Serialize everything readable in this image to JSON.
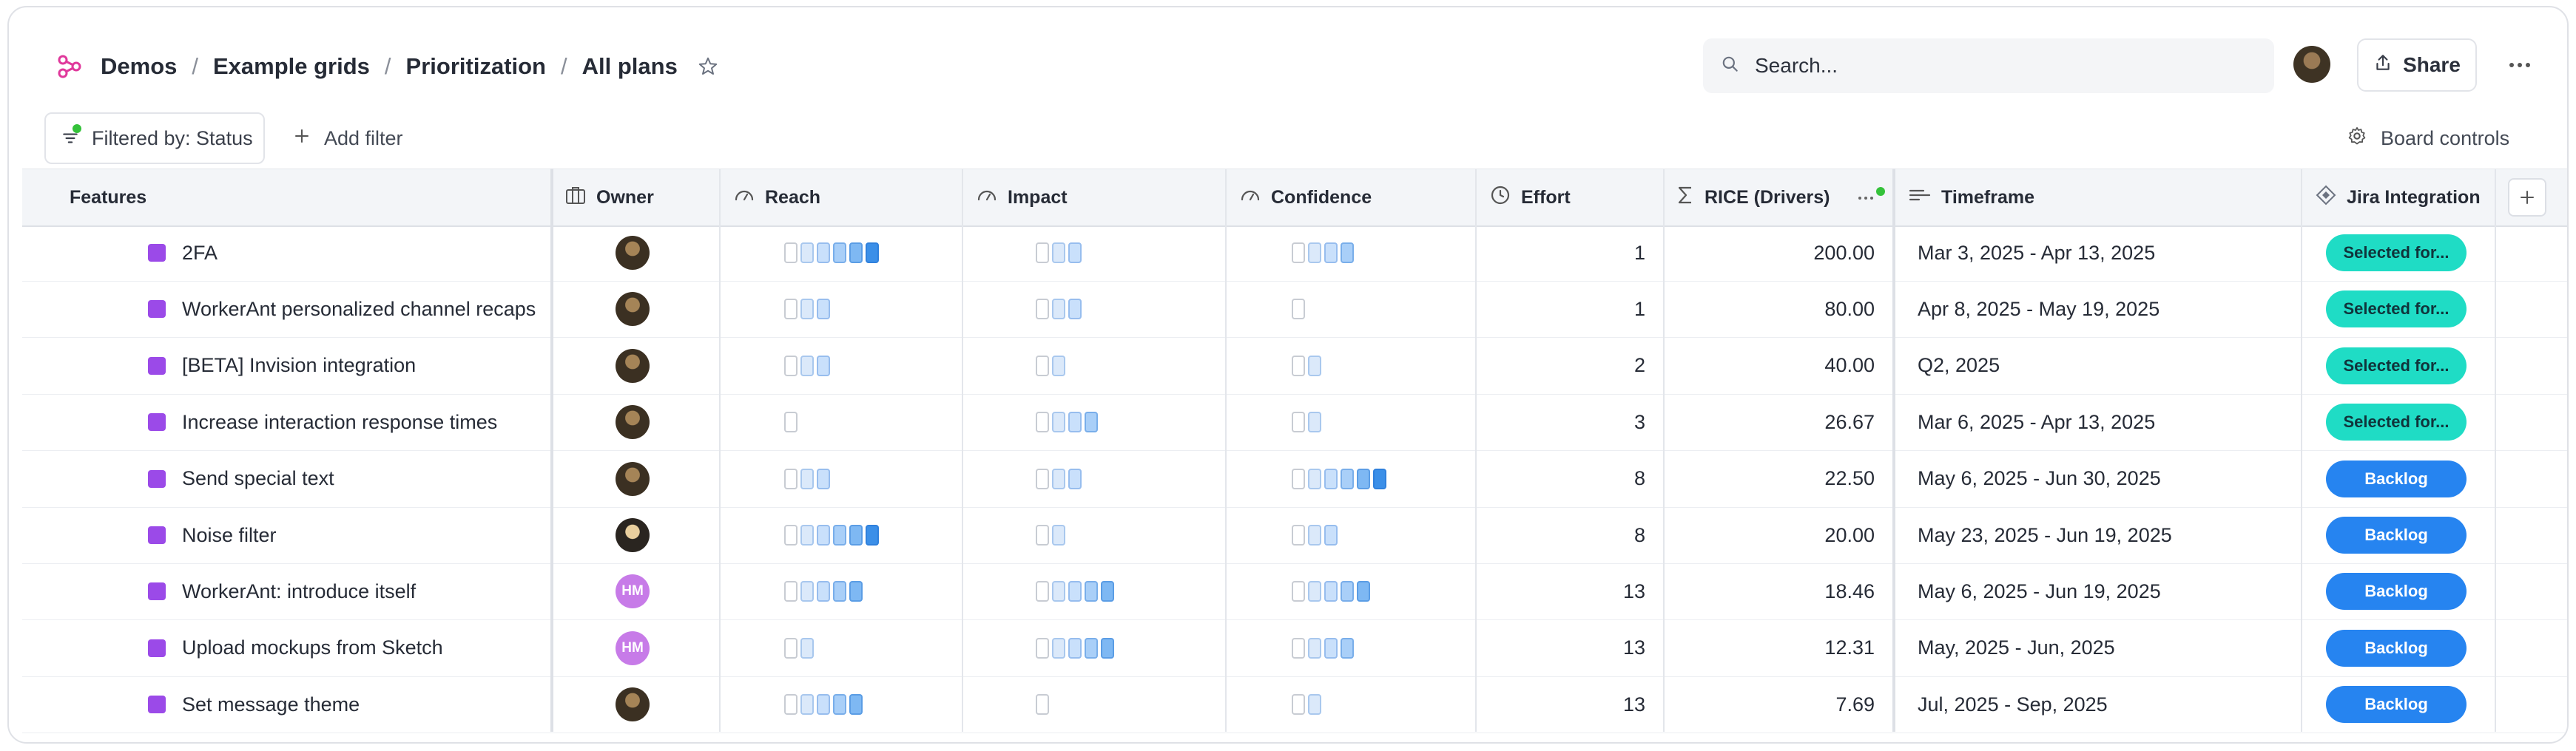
{
  "breadcrumb": [
    "Demos",
    "Example grids",
    "Prioritization",
    "All plans"
  ],
  "search": {
    "placeholder": "Search..."
  },
  "share_label": "Share",
  "filter_label": "Filtered by: Status",
  "add_filter_label": "Add filter",
  "board_controls_label": "Board controls",
  "columns": {
    "features": "Features",
    "owner": "Owner",
    "reach": "Reach",
    "impact": "Impact",
    "confidence": "Confidence",
    "effort": "Effort",
    "rice": "RICE (Drivers)",
    "timeframe": "Timeframe",
    "jira": "Jira Integration"
  },
  "colors": {
    "feature": "#9b4ae8",
    "selected": "#1fdcc5",
    "backlog": "#2684f0",
    "accent": "#e0389b"
  },
  "rows": [
    {
      "name": "2FA",
      "owner": "photo",
      "reach": 6,
      "impact": 3,
      "confidence": 4,
      "effort": "1",
      "rice": "200.00",
      "timeframe": "Mar 3, 2025 - Apr 13, 2025",
      "jira": "Selected for...",
      "jira_status": "selected"
    },
    {
      "name": "WorkerAnt personalized channel recaps",
      "owner": "photo",
      "reach": 3,
      "impact": 3,
      "confidence": 1,
      "effort": "1",
      "rice": "80.00",
      "timeframe": "Apr 8, 2025 - May 19, 2025",
      "jira": "Selected for...",
      "jira_status": "selected"
    },
    {
      "name": "[BETA] Invision integration",
      "owner": "photo",
      "reach": 3,
      "impact": 2,
      "confidence": 2,
      "effort": "2",
      "rice": "40.00",
      "timeframe": "Q2, 2025",
      "jira": "Selected for...",
      "jira_status": "selected"
    },
    {
      "name": "Increase interaction response times",
      "owner": "photo",
      "reach": 1,
      "impact": 4,
      "confidence": 2,
      "effort": "3",
      "rice": "26.67",
      "timeframe": "Mar 6, 2025 - Apr 13, 2025",
      "jira": "Selected for...",
      "jira_status": "selected"
    },
    {
      "name": "Send special text",
      "owner": "photo",
      "reach": 3,
      "impact": 3,
      "confidence": 6,
      "effort": "8",
      "rice": "22.50",
      "timeframe": "May 6, 2025 - Jun 30, 2025",
      "jira": "Backlog",
      "jira_status": "backlog"
    },
    {
      "name": "Noise filter",
      "owner": "photo2",
      "reach": 6,
      "impact": 2,
      "confidence": 3,
      "effort": "8",
      "rice": "20.00",
      "timeframe": "May 23, 2025 - Jun 19, 2025",
      "jira": "Backlog",
      "jira_status": "backlog"
    },
    {
      "name": "WorkerAnt: introduce itself",
      "owner": "HM",
      "reach": 5,
      "impact": 5,
      "confidence": 5,
      "effort": "13",
      "rice": "18.46",
      "timeframe": "May 6, 2025 - Jun 19, 2025",
      "jira": "Backlog",
      "jira_status": "backlog"
    },
    {
      "name": "Upload mockups from Sketch",
      "owner": "HM",
      "reach": 2,
      "impact": 5,
      "confidence": 4,
      "effort": "13",
      "rice": "12.31",
      "timeframe": "May, 2025 - Jun, 2025",
      "jira": "Backlog",
      "jira_status": "backlog"
    },
    {
      "name": "Set message theme",
      "owner": "photo",
      "reach": 5,
      "impact": 1,
      "confidence": 2,
      "effort": "13",
      "rice": "7.69",
      "timeframe": "Jul, 2025 - Sep, 2025",
      "jira": "Backlog",
      "jira_status": "backlog"
    }
  ]
}
